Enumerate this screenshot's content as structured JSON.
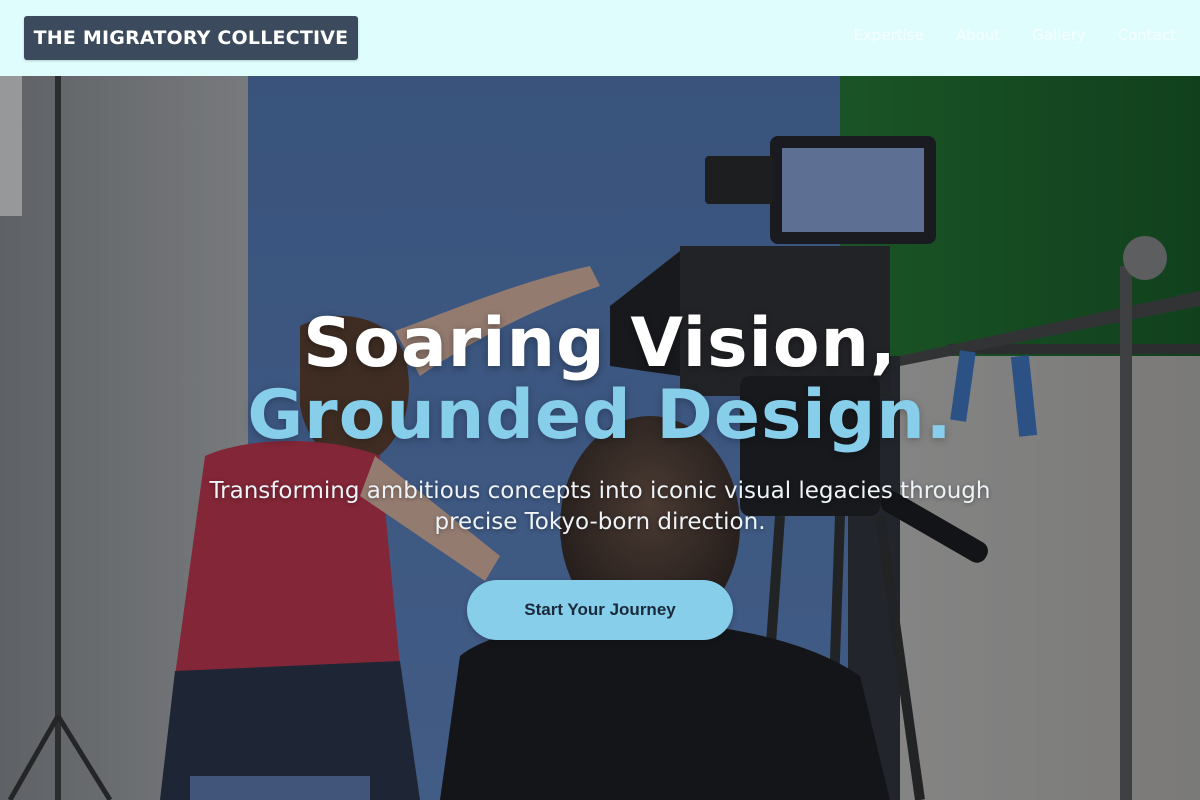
{
  "header": {
    "brand": "THE MIGRATORY COLLECTIVE",
    "nav": [
      "Expertise",
      "About",
      "Gallery",
      "Contact"
    ]
  },
  "hero": {
    "headline_line1": "Soaring Vision,",
    "headline_line2": "Grounded Design.",
    "subtitle": "Transforming ambitious concepts into iconic visual legacies through precise Tokyo-born direction.",
    "cta_label": "Start Your Journey",
    "background": "film studio photo: camera crew in front of blue and green screens"
  },
  "colors": {
    "header_bg": "#e0fdfd",
    "brand_bg": "#3b4a5c",
    "accent": "#87ceeb",
    "headline_white": "#ffffff"
  }
}
